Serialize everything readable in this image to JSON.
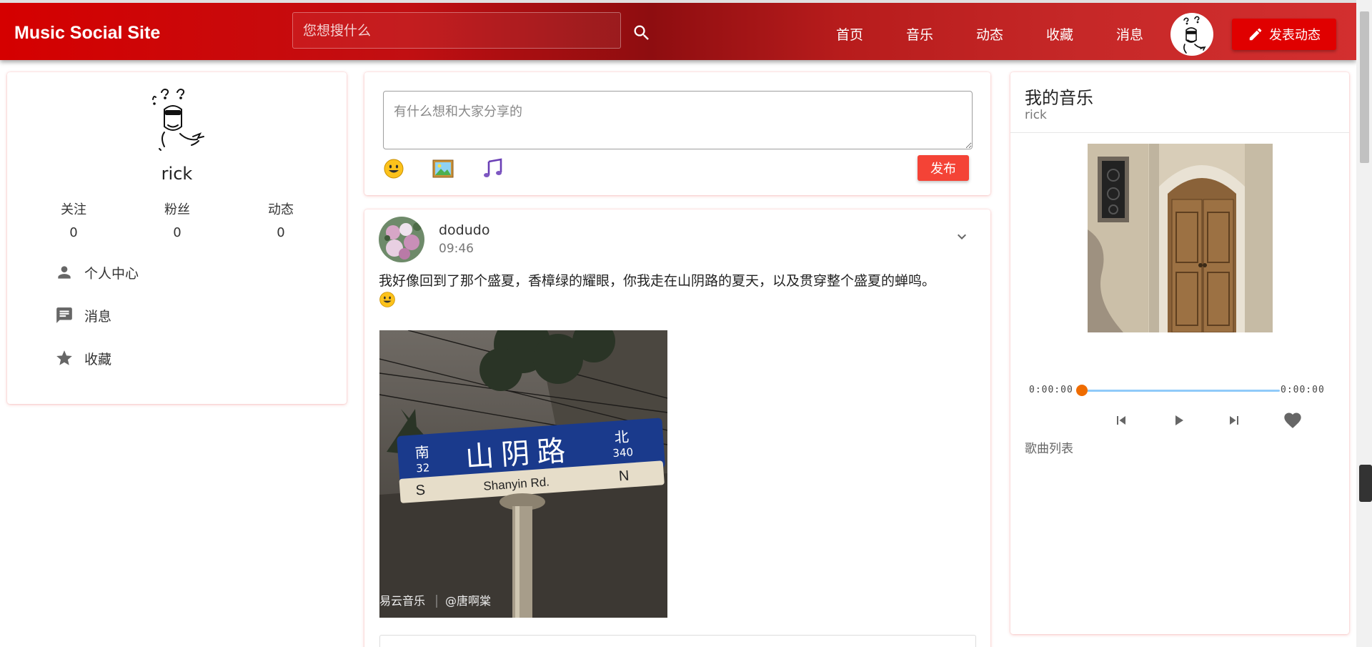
{
  "header": {
    "brand": "Music Social Site",
    "search_placeholder": "您想搜什么",
    "nav": [
      "首页",
      "音乐",
      "动态",
      "收藏",
      "消息"
    ],
    "post_button": "发表动态"
  },
  "profile": {
    "name": "rick",
    "stats": [
      {
        "label": "关注",
        "value": "0"
      },
      {
        "label": "粉丝",
        "value": "0"
      },
      {
        "label": "动态",
        "value": "0"
      }
    ],
    "menu": [
      {
        "label": "个人中心",
        "icon": "person-icon"
      },
      {
        "label": "消息",
        "icon": "message-icon"
      },
      {
        "label": "收藏",
        "icon": "star-icon"
      }
    ]
  },
  "composer": {
    "placeholder": "有什么想和大家分享的",
    "publish": "发布",
    "tools": [
      "emoji-icon",
      "image-icon",
      "music-note-icon"
    ]
  },
  "post": {
    "user": "dodudo",
    "time": "09:46",
    "text": "我好像回到了那个盛夏，香樟绿的耀眼，你我走在山阴路的夏天，以及贯穿整个盛夏的蝉鸣。",
    "image_sign": {
      "south": "南",
      "south_num": "32",
      "road": "山阴路",
      "north": "北",
      "north_num": "340",
      "english": "Shanyin Rd.",
      "s": "S",
      "n": "N"
    },
    "watermark": "易云音乐",
    "watermark_user": "@唐啊棠"
  },
  "music": {
    "title": "我的音乐",
    "subtitle": "rick",
    "time_start": "0:00:00",
    "time_end": "0:00:00",
    "progress": 0,
    "playlist_label": "歌曲列表"
  },
  "colors": {
    "header_red": "#d50000",
    "button_red": "#f44336",
    "progress_thumb": "#ef6c00",
    "progress_track": "#90caf9"
  }
}
